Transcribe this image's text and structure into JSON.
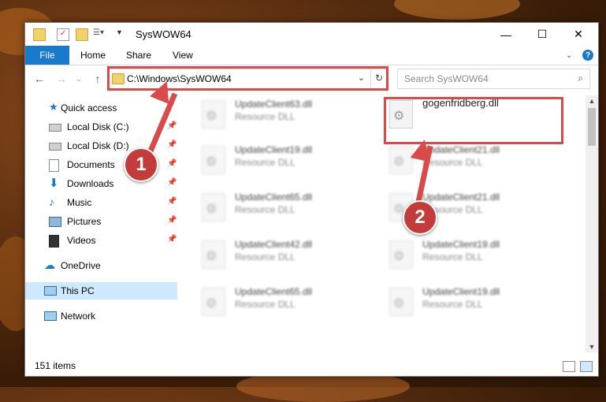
{
  "window": {
    "title": "SysWOW64"
  },
  "ribbon": {
    "tabs": [
      "File",
      "Home",
      "Share",
      "View"
    ],
    "help": "?"
  },
  "address": {
    "path": "C:\\Windows\\SysWOW64",
    "search_placeholder": "Search SysWOW64"
  },
  "sidebar": {
    "items": [
      {
        "label": "Quick access",
        "icon": "star-icon"
      },
      {
        "label": "Local Disk (C:)",
        "icon": "drive-icon",
        "pinned": true
      },
      {
        "label": "Local Disk (D:)",
        "icon": "drive-icon",
        "pinned": true
      },
      {
        "label": "Documents",
        "icon": "document-icon",
        "pinned": true
      },
      {
        "label": "Downloads",
        "icon": "download-icon",
        "pinned": true
      },
      {
        "label": "Music",
        "icon": "music-icon",
        "pinned": true
      },
      {
        "label": "Pictures",
        "icon": "pictures-icon",
        "pinned": true
      },
      {
        "label": "Videos",
        "icon": "video-icon",
        "pinned": true
      },
      {
        "label": "OneDrive",
        "icon": "cloud-icon"
      },
      {
        "label": "This PC",
        "icon": "computer-icon",
        "selected": true
      },
      {
        "label": "Network",
        "icon": "network-icon"
      }
    ]
  },
  "files": {
    "left": [
      {
        "name": "UpdateClient63.dll",
        "type": "Resource DLL"
      },
      {
        "name": "UpdateClient19.dll",
        "type": "Resource DLL"
      },
      {
        "name": "UpdateClient65.dll",
        "type": "Resource DLL"
      },
      {
        "name": "UpdateClient42.dll",
        "type": "Resource DLL"
      },
      {
        "name": "UpdateClient65.dll",
        "type": "Resource DLL"
      }
    ],
    "right": [
      {
        "name": "gogenfridberg.dll",
        "type": ""
      },
      {
        "name": "UpdateClient21.dll",
        "type": "Resource DLL"
      },
      {
        "name": "UpdateClient21.dll",
        "type": "Resource DLL"
      },
      {
        "name": "UpdateClient19.dll",
        "type": "Resource DLL"
      },
      {
        "name": "UpdateClient19.dll",
        "type": "Resource DLL"
      }
    ]
  },
  "status": {
    "item_count": "151 items"
  },
  "annotations": {
    "badge_1": "1",
    "badge_2": "2"
  },
  "colors": {
    "accent": "#1979ca",
    "highlight": "#d94a4a",
    "selected_bg": "#cde8ff"
  }
}
